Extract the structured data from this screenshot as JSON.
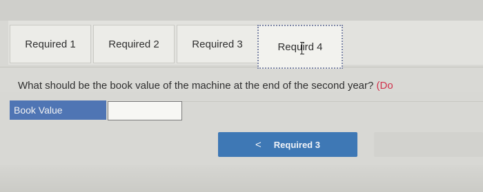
{
  "tabs": [
    {
      "label": "Required 1",
      "active": false
    },
    {
      "label": "Required 2",
      "active": false
    },
    {
      "label": "Required 3",
      "active": false
    },
    {
      "label_pre": "Requir",
      "label_post": "d 4",
      "active": true
    }
  ],
  "question": {
    "text": "What should be the book value of the machine at the end of the second year?",
    "hint": "(Do"
  },
  "book_value": {
    "label": "Book Value",
    "value": ""
  },
  "navigation": {
    "prev_icon": "chevron-left-icon",
    "prev_glyph": "<",
    "prev_label": "Required 3"
  },
  "colors": {
    "accent": "#3e78b5",
    "label_fill": "#4f75b4",
    "hint": "#d1334d"
  }
}
